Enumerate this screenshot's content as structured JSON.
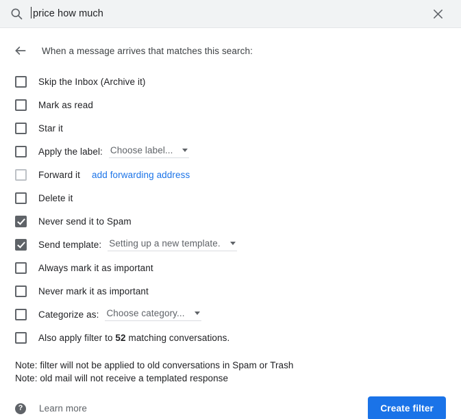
{
  "search": {
    "icon": "search-icon",
    "value": "price how much",
    "close_icon": "close-icon"
  },
  "panel": {
    "back_icon": "arrow-left-icon",
    "title": "When a message arrives that matches this search:"
  },
  "options": [
    {
      "label": "Skip the Inbox (Archive it)",
      "checked": false,
      "disabled": false,
      "name": "skip-inbox"
    },
    {
      "label": "Mark as read",
      "checked": false,
      "disabled": false,
      "name": "mark-as-read"
    },
    {
      "label": "Star it",
      "checked": false,
      "disabled": false,
      "name": "star-it"
    },
    {
      "label": "Apply the label:",
      "checked": false,
      "disabled": false,
      "name": "apply-label",
      "dropdown": "Choose label..."
    },
    {
      "label": "Forward it",
      "checked": false,
      "disabled": true,
      "name": "forward-it",
      "link": "add forwarding address"
    },
    {
      "label": "Delete it",
      "checked": false,
      "disabled": false,
      "name": "delete-it"
    },
    {
      "label": "Never send it to Spam",
      "checked": true,
      "disabled": false,
      "name": "never-send-to-spam"
    },
    {
      "label": "Send template:",
      "checked": true,
      "disabled": false,
      "name": "send-template",
      "dropdown": "Setting up a new template.",
      "wide": true
    },
    {
      "label": "Always mark it as important",
      "checked": false,
      "disabled": false,
      "name": "always-mark-important"
    },
    {
      "label": "Never mark it as important",
      "checked": false,
      "disabled": false,
      "name": "never-mark-important"
    },
    {
      "label": "Categorize as:",
      "checked": false,
      "disabled": false,
      "name": "categorize-as",
      "dropdown": "Choose category..."
    },
    {
      "label_pre": "Also apply filter to ",
      "count": "52",
      "label_post": " matching conversations.",
      "checked": false,
      "disabled": false,
      "name": "also-apply-filter"
    }
  ],
  "notes": {
    "line1": "Note: filter will not be applied to old conversations in Spam or Trash",
    "line2": "Note: old mail will not receive a templated response"
  },
  "footer": {
    "help_icon": "help-icon",
    "help_glyph": "?",
    "learn_more": "Learn more",
    "create_filter": "Create filter"
  },
  "colors": {
    "accent": "#1a73e8",
    "link": "#1a73e8",
    "header_bg": "#f1f3f4",
    "checkbox": "#5f6368",
    "text": "#202124"
  }
}
